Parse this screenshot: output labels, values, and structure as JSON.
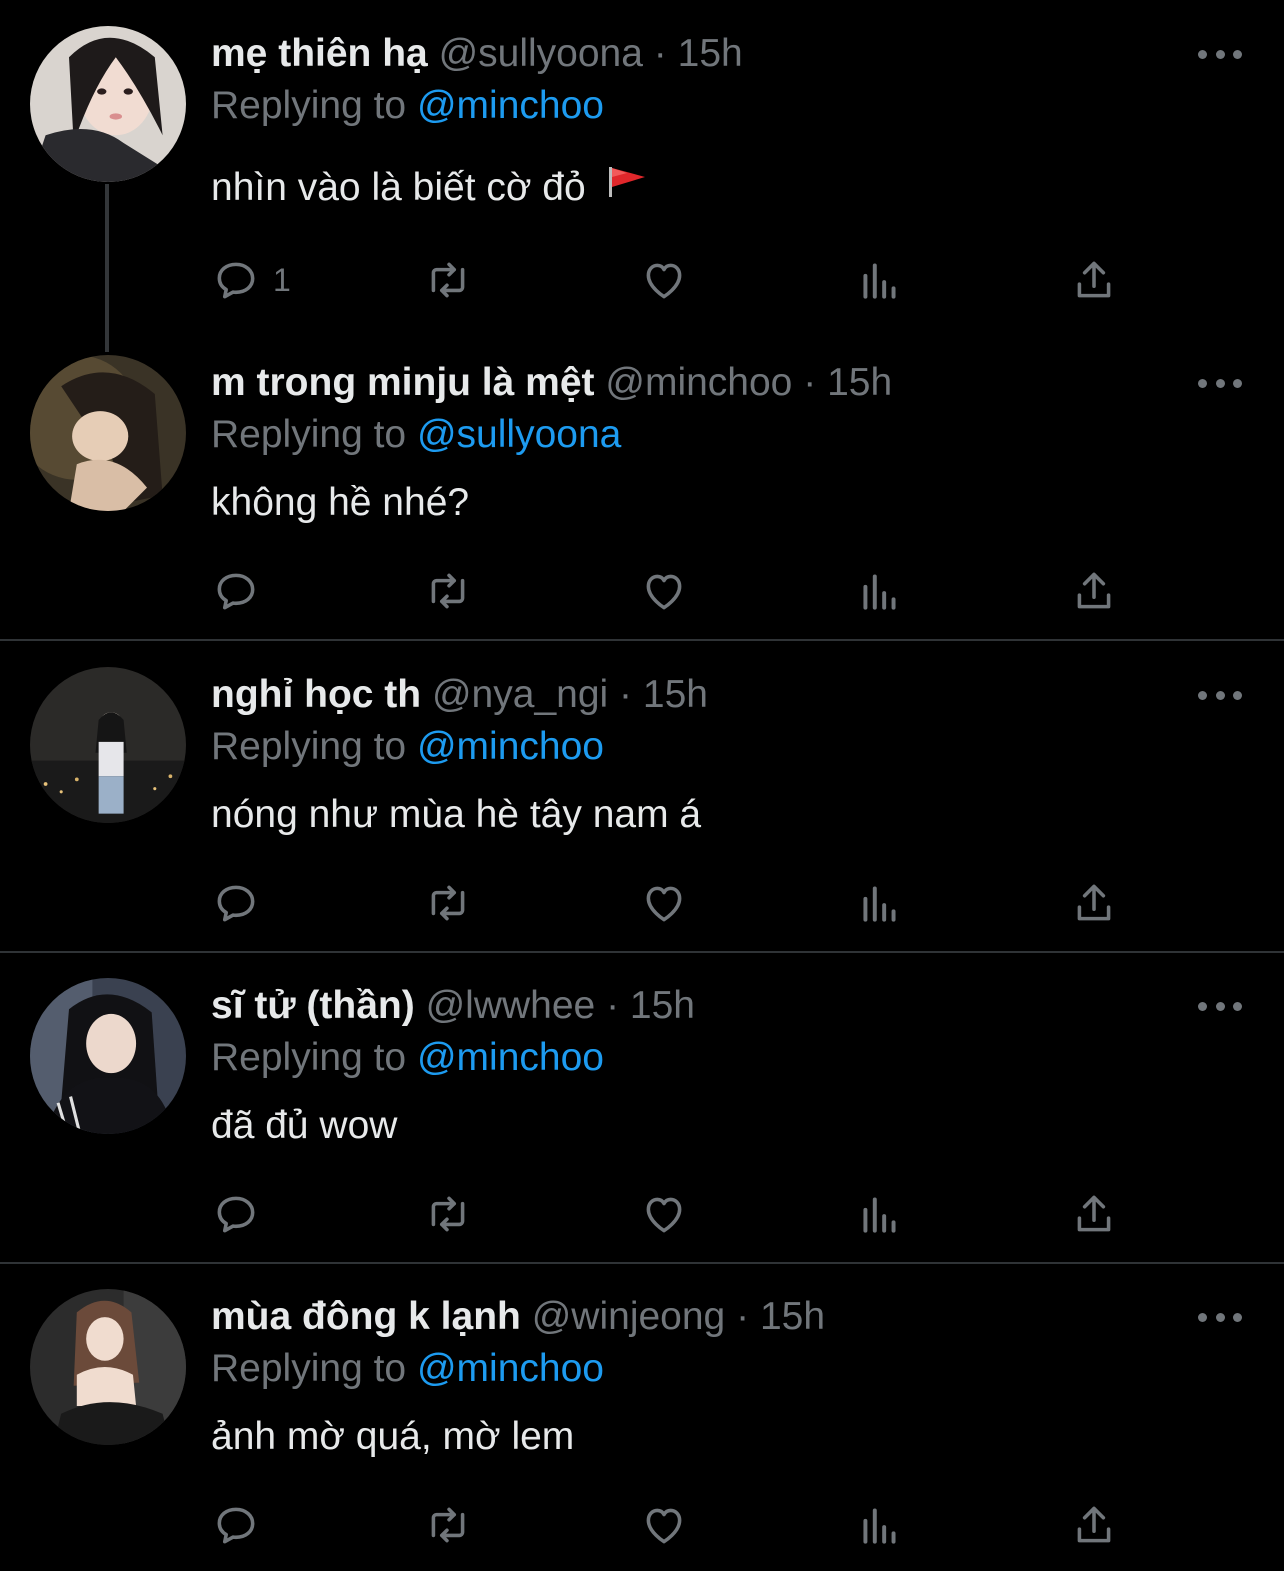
{
  "colors": {
    "background": "#000000",
    "text": "#e7e9ea",
    "muted": "#71767b",
    "accent": "#1d9bf0",
    "divider": "#2f3336"
  },
  "reply_prefix": "Replying to",
  "dot": "·",
  "tweets": [
    {
      "name": "mẹ thiên hạ",
      "handle": "@sullyoona",
      "time": "15h",
      "replying_to": "@minchoo",
      "text": "nhìn vào là biết cờ đỏ",
      "emoji": "red-flag-icon",
      "reply_count": "1"
    },
    {
      "name": "m trong minju là mệt",
      "handle": "@minchoo",
      "time": "15h",
      "replying_to": "@sullyoona",
      "text": "không hề nhé?",
      "reply_count": ""
    },
    {
      "name": "nghỉ học th",
      "handle": "@nya_ngi",
      "time": "15h",
      "replying_to": "@minchoo",
      "text": "nóng như mùa hè tây nam á",
      "reply_count": ""
    },
    {
      "name": "sĩ tử (thần)",
      "handle": "@lwwhee",
      "time": "15h",
      "replying_to": "@minchoo",
      "text": "đã đủ wow",
      "reply_count": ""
    },
    {
      "name": "mùa đông k lạnh",
      "handle": "@winjeong",
      "time": "15h",
      "replying_to": "@minchoo",
      "text": "ảnh mờ quá, mờ lem",
      "reply_count": ""
    }
  ],
  "icons": {
    "reply": "reply-icon",
    "retweet": "retweet-icon",
    "like": "heart-icon",
    "views": "views-icon",
    "share": "share-icon",
    "more": "more-icon"
  }
}
